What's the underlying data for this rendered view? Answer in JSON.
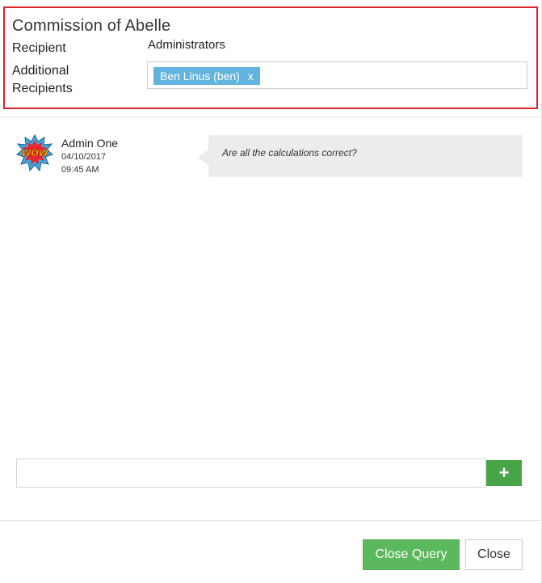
{
  "dialog": {
    "title": "Commission of Abelle",
    "recipient_label": "Recipient",
    "recipient_value": "Administrators",
    "additional_label": "Additional Recipients",
    "additional_tags": [
      {
        "label": "Ben Linus (ben)",
        "remove": "x"
      }
    ]
  },
  "messages": [
    {
      "author": "Admin One",
      "date": "04/10/2017",
      "time": "09:45 AM",
      "avatar_text": "WOW",
      "text": "Are all the calculations correct?"
    }
  ],
  "reply": {
    "value": "",
    "placeholder": "",
    "add_icon": "plus-icon",
    "add_label": "+"
  },
  "footer": {
    "close_query_label": "Close Query",
    "close_label": "Close"
  },
  "colors": {
    "highlight_border": "#d9252b",
    "tag_bg": "#63b3df",
    "success": "#5cb85c",
    "add_button": "#47a447",
    "bubble_bg": "#ececec"
  }
}
